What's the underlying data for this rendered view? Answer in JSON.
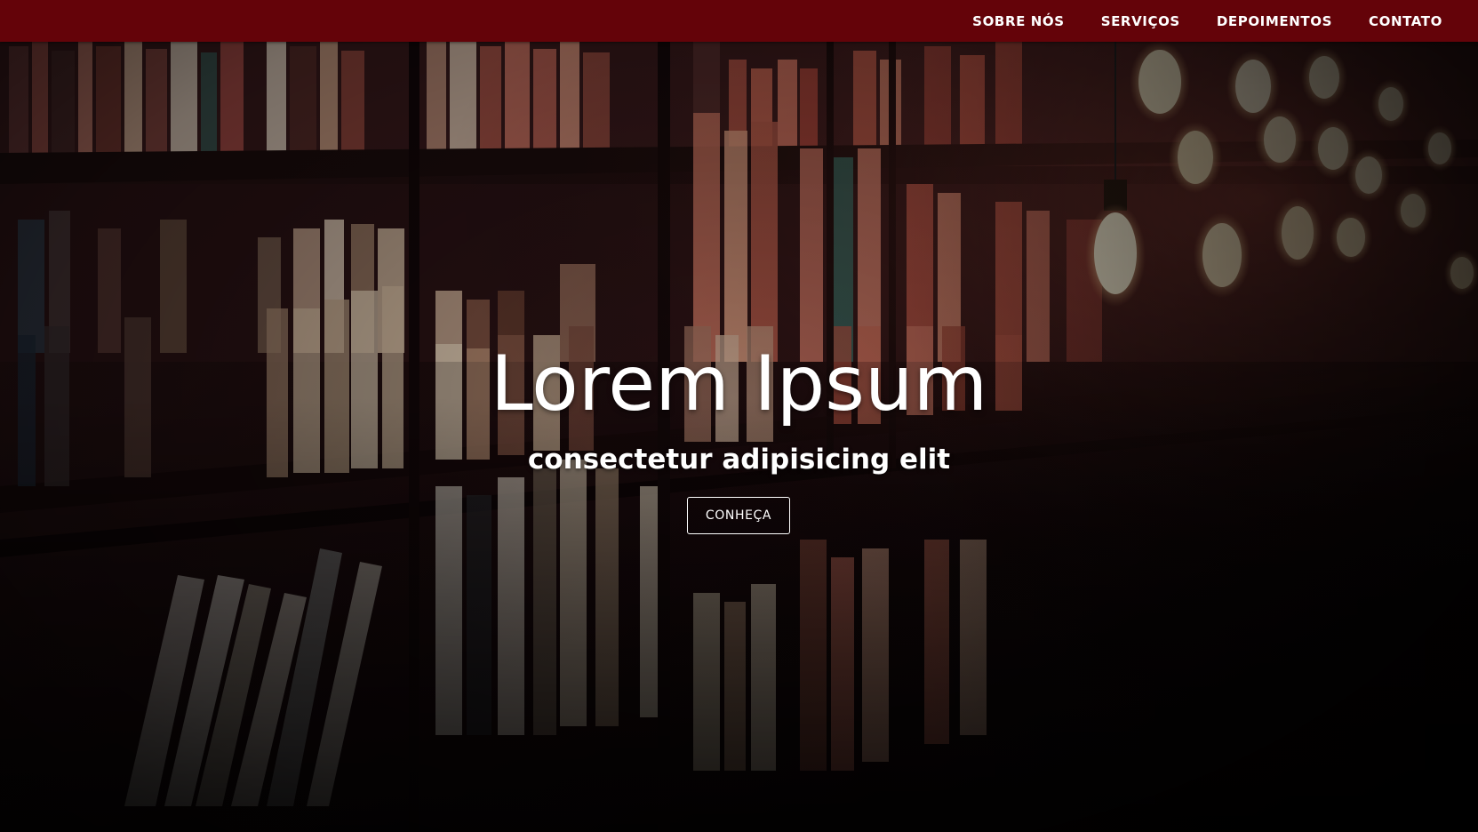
{
  "navbar": {
    "background_color": "#640309",
    "links": [
      {
        "label": "SOBRE NÓS"
      },
      {
        "label": "SERVIÇOS"
      },
      {
        "label": "DEPOIMENTOS"
      },
      {
        "label": "CONTATO"
      }
    ]
  },
  "hero": {
    "background_image": "bookshelf-with-hanging-lightbulbs",
    "title": "Lorem Ipsum",
    "subtitle": "consectetur adipisicing elit",
    "button_label": "CONHEÇA"
  }
}
